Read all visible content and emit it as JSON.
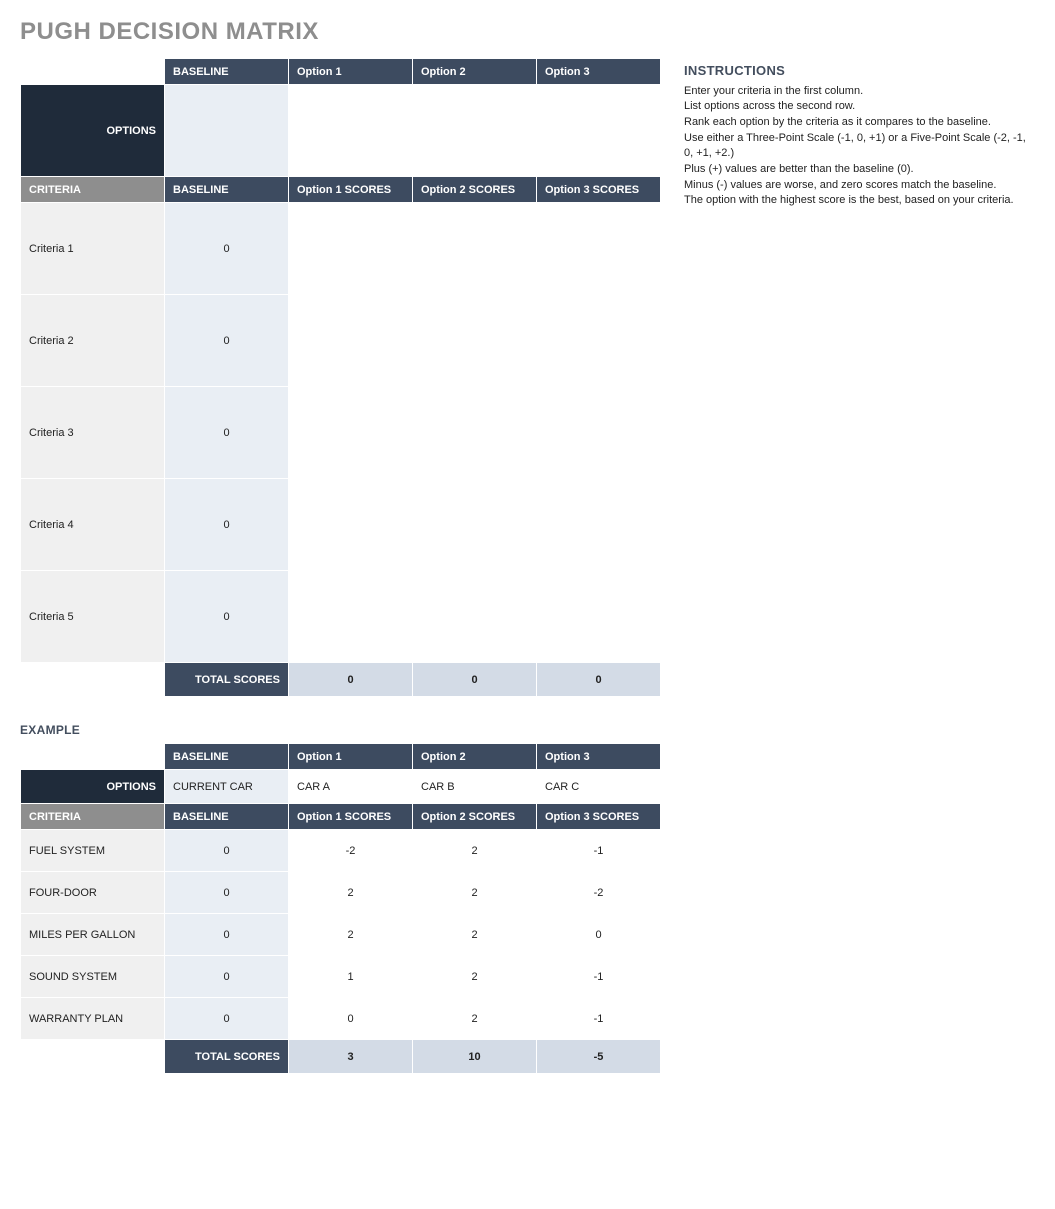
{
  "title": "PUGH DECISION MATRIX",
  "instructions": {
    "heading": "INSTRUCTIONS",
    "lines": [
      "Enter your criteria in the first column.",
      "List options across the second row.",
      "Rank each option by the criteria as it compares to the baseline.",
      "Use either a Three-Point Scale (-1, 0, +1) or a Five-Point Scale (-2, -1, 0, +1, +2.)",
      "Plus (+) values are better than the baseline (0).",
      "Minus (-) values are worse, and zero scores match the baseline.",
      "The option with the highest score is the best, based on your criteria."
    ]
  },
  "labels": {
    "options": "OPTIONS",
    "criteria": "CRITERIA",
    "baseline": "BASELINE",
    "totalScores": "TOTAL SCORES"
  },
  "mainMatrix": {
    "optionHeaders": [
      "BASELINE",
      "Option 1",
      "Option 2",
      "Option 3"
    ],
    "optionValues": [
      "",
      "",
      "",
      ""
    ],
    "scoreHeaders": [
      "BASELINE",
      "Option 1 SCORES",
      "Option 2 SCORES",
      "Option 3 SCORES"
    ],
    "rows": [
      {
        "criteria": "Criteria 1",
        "baseline": "0",
        "scores": [
          "",
          "",
          ""
        ]
      },
      {
        "criteria": "Criteria 2",
        "baseline": "0",
        "scores": [
          "",
          "",
          ""
        ]
      },
      {
        "criteria": "Criteria 3",
        "baseline": "0",
        "scores": [
          "",
          "",
          ""
        ]
      },
      {
        "criteria": "Criteria 4",
        "baseline": "0",
        "scores": [
          "",
          "",
          ""
        ]
      },
      {
        "criteria": "Criteria 5",
        "baseline": "0",
        "scores": [
          "",
          "",
          ""
        ]
      }
    ],
    "totals": [
      "0",
      "0",
      "0"
    ]
  },
  "exampleHeading": "EXAMPLE",
  "exampleMatrix": {
    "optionHeaders": [
      "BASELINE",
      "Option 1",
      "Option 2",
      "Option 3"
    ],
    "optionValues": [
      "CURRENT CAR",
      "CAR A",
      "CAR B",
      "CAR C"
    ],
    "scoreHeaders": [
      "BASELINE",
      "Option 1 SCORES",
      "Option 2 SCORES",
      "Option 3 SCORES"
    ],
    "rows": [
      {
        "criteria": "FUEL SYSTEM",
        "baseline": "0",
        "scores": [
          "-2",
          "2",
          "-1"
        ]
      },
      {
        "criteria": "FOUR-DOOR",
        "baseline": "0",
        "scores": [
          "2",
          "2",
          "-2"
        ]
      },
      {
        "criteria": "MILES PER GALLON",
        "baseline": "0",
        "scores": [
          "2",
          "2",
          "0"
        ]
      },
      {
        "criteria": "SOUND SYSTEM",
        "baseline": "0",
        "scores": [
          "1",
          "2",
          "-1"
        ]
      },
      {
        "criteria": "WARRANTY PLAN",
        "baseline": "0",
        "scores": [
          "0",
          "2",
          "-1"
        ]
      }
    ],
    "totals": [
      "3",
      "10",
      "-5"
    ]
  }
}
